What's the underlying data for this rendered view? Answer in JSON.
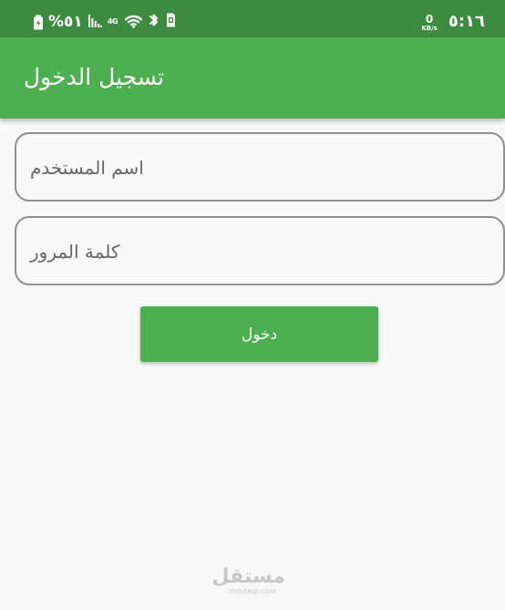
{
  "status_bar": {
    "battery_percent": "%٥١",
    "network_type": "4G",
    "network_speed_value": "0",
    "network_speed_unit": "KB/s",
    "time": "٥:١٦",
    "icons": {
      "battery": "battery-charging-icon",
      "signal": "signal-icon",
      "wifi": "wifi-icon",
      "bluetooth": "bluetooth-icon",
      "sim": "sim-card-icon"
    },
    "colors": {
      "background": "#3d8b40",
      "foreground": "#ffffff"
    }
  },
  "app_bar": {
    "title": "تسجيل الدخول",
    "color": "#4caf50"
  },
  "form": {
    "username_placeholder": "اسم المستخدم",
    "password_placeholder": "كلمة المرور",
    "login_button_label": "دخول"
  },
  "watermark": {
    "main": "مستقل",
    "sub": "mostaql.com"
  }
}
